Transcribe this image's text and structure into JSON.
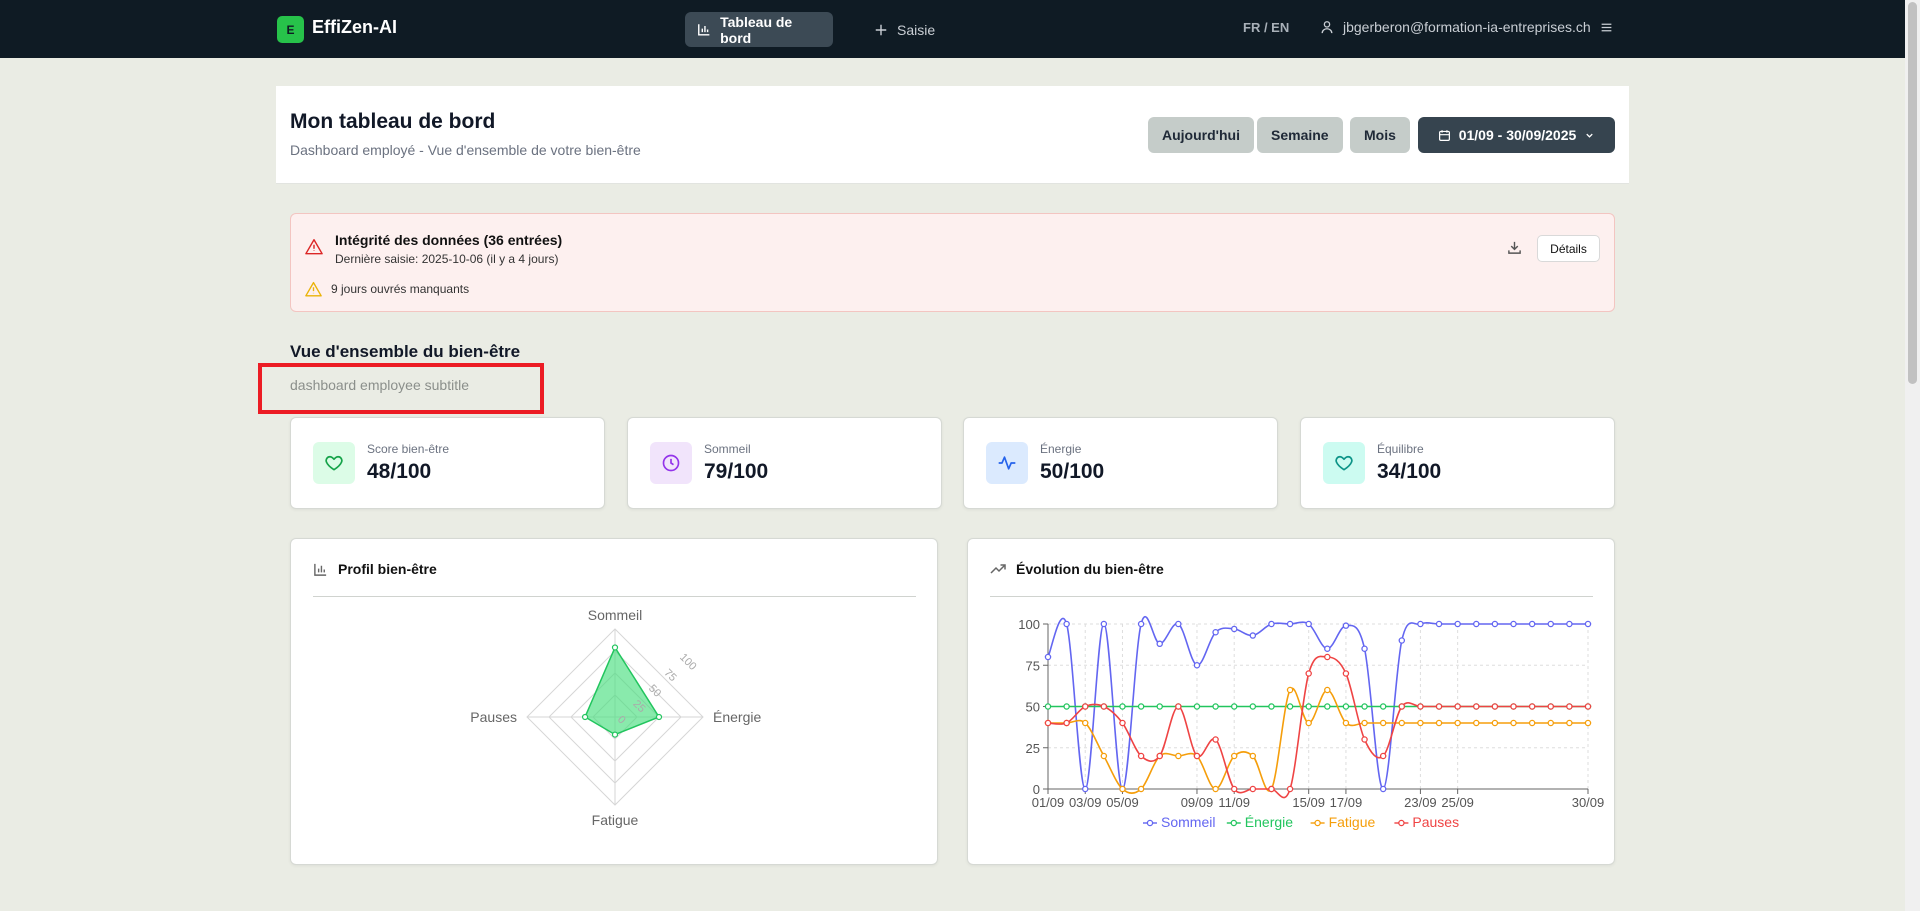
{
  "nav": {
    "logo_letter": "E",
    "brand": "EffiZen-AI",
    "tabs": [
      {
        "label": "Tableau de bord"
      },
      {
        "label": "Saisie"
      }
    ],
    "lang": "FR / EN",
    "user_email": "jbgerberon@formation-ia-entreprises.ch"
  },
  "header": {
    "title": "Mon tableau de bord",
    "subtitle": "Dashboard employé - Vue d'ensemble de votre bien-être",
    "periods": [
      "Aujourd'hui",
      "Semaine",
      "Mois"
    ],
    "date_range": "01/09 - 30/09/2025"
  },
  "alert": {
    "title": "Intégrité des données (36 entrées)",
    "last_entry": "Dernière saisie: 2025-10-06 (il y a 4 jours)",
    "missing": "9 jours ouvrés manquants",
    "details_label": "Détails"
  },
  "overview": {
    "title": "Vue d'ensemble du bien-être",
    "subtitle": "dashboard employee subtitle"
  },
  "metrics": [
    {
      "label": "Score bien-être",
      "value": "48/100",
      "icon": "heart-icon",
      "bg": "#dcfce7",
      "color": "#16a34a"
    },
    {
      "label": "Sommeil",
      "value": "79/100",
      "icon": "clock-icon",
      "bg": "#f1e4fb",
      "color": "#9333ea"
    },
    {
      "label": "Énergie",
      "value": "50/100",
      "icon": "activity-icon",
      "bg": "#dbeafe",
      "color": "#2563eb"
    },
    {
      "label": "Équilibre",
      "value": "34/100",
      "icon": "heart-icon",
      "bg": "#ccfbf1",
      "color": "#0d9488"
    }
  ],
  "radar": {
    "title": "Profil bien-être",
    "axes": [
      "Sommeil",
      "Énergie",
      "Fatigue",
      "Pauses"
    ],
    "ticks": [
      "0",
      "25",
      "50",
      "75",
      "100"
    ],
    "values": [
      79,
      50,
      20,
      34
    ],
    "color": "#4ade80"
  },
  "chart_data": {
    "type": "line",
    "title": "Évolution du bien-être",
    "x": [
      "01/09",
      "02/09",
      "03/09",
      "04/09",
      "05/09",
      "06/09",
      "07/09",
      "08/09",
      "09/09",
      "10/09",
      "11/09",
      "12/09",
      "13/09",
      "14/09",
      "15/09",
      "16/09",
      "17/09",
      "18/09",
      "19/09",
      "20/09",
      "21/09",
      "22/09",
      "23/09",
      "24/09",
      "25/09",
      "26/09",
      "27/09",
      "28/09",
      "29/09",
      "30/09"
    ],
    "xticks": [
      "01/09",
      "03/09",
      "05/09",
      "09/09",
      "11/09",
      "15/09",
      "17/09",
      "23/09",
      "25/09",
      "30/09"
    ],
    "xtick_index": [
      0,
      2,
      4,
      8,
      10,
      14,
      16,
      20,
      22,
      29
    ],
    "ylim": [
      0,
      100
    ],
    "yticks": [
      "0",
      "25",
      "50",
      "75",
      "100"
    ],
    "grid": true,
    "legend": "bottom",
    "series": [
      {
        "name": "Sommeil",
        "color": "#6366f1",
        "values": [
          80,
          100,
          0,
          100,
          0,
          100,
          88,
          100,
          75,
          95,
          97,
          93,
          100,
          100,
          100,
          85,
          99,
          85,
          0,
          90,
          100,
          100,
          100,
          100,
          100,
          100,
          100,
          100,
          100,
          100
        ]
      },
      {
        "name": "Énergie",
        "color": "#22c55e",
        "values": [
          50,
          50,
          50,
          50,
          50,
          50,
          50,
          50,
          50,
          50,
          50,
          50,
          50,
          50,
          50,
          50,
          50,
          50,
          50,
          50,
          50,
          50,
          50,
          50,
          50,
          50,
          50,
          50,
          50,
          50
        ]
      },
      {
        "name": "Fatigue",
        "color": "#f59e0b",
        "values": [
          40,
          40,
          40,
          20,
          0,
          0,
          20,
          20,
          20,
          0,
          20,
          20,
          0,
          60,
          40,
          60,
          40,
          40,
          40,
          40,
          40,
          40,
          40,
          40,
          40,
          40,
          40,
          40,
          40,
          40
        ]
      },
      {
        "name": "Pauses",
        "color": "#ef4444",
        "values": [
          40,
          40,
          50,
          50,
          40,
          20,
          20,
          50,
          20,
          30,
          0,
          0,
          0,
          0,
          70,
          80,
          70,
          30,
          20,
          50,
          50,
          50,
          50,
          50,
          50,
          50,
          50,
          50,
          50,
          50
        ]
      }
    ]
  }
}
